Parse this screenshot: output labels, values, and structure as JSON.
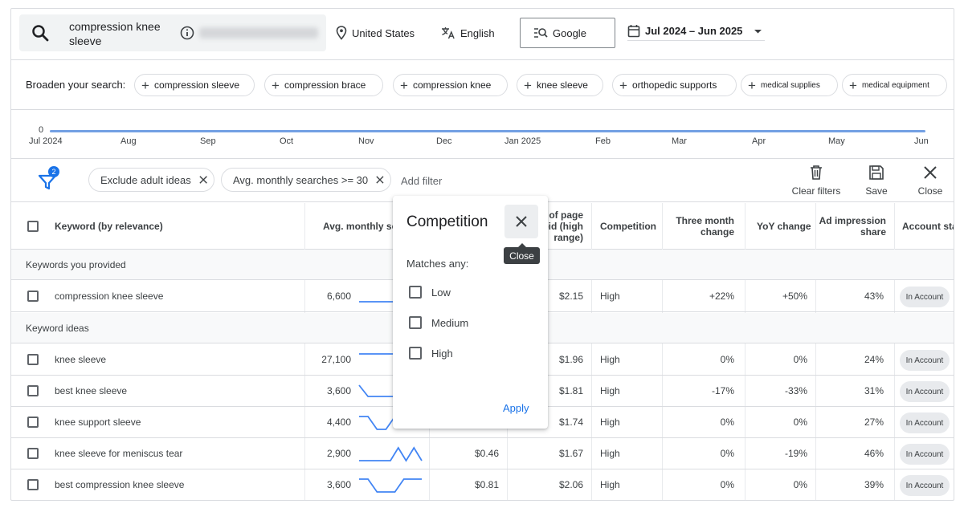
{
  "search": {
    "query": "compression knee sleeve",
    "location": "United States",
    "language": "English",
    "engine": "Google",
    "date_range": "Jul 2024 – Jun 2025"
  },
  "broaden": {
    "label": "Broaden your search:",
    "chips": [
      "compression sleeve",
      "compression brace",
      "compression knee",
      "knee sleeve",
      "orthopedic supports",
      "medical supplies",
      "medical equipment"
    ]
  },
  "timeline": {
    "zero_label": "0",
    "months": [
      "Jul 2024",
      "Aug",
      "Sep",
      "Oct",
      "Nov",
      "Dec",
      "Jan 2025",
      "Feb",
      "Mar",
      "Apr",
      "May",
      "Jun"
    ]
  },
  "filters": {
    "badge": "2",
    "chips": [
      "Exclude adult ideas",
      "Avg. monthly searches >= 30"
    ],
    "add_filter": "Add filter",
    "clear_label": "Clear filters",
    "save_label": "Save",
    "close_label": "Close"
  },
  "table": {
    "headers": {
      "keyword": "Keyword (by relevance)",
      "avg_searches": "Avg. monthly sea",
      "top_bid_line1": "of page",
      "top_bid_line2": "bid (high",
      "top_bid_line3": "range)",
      "competition": "Competition",
      "three_month_line1": "Three month",
      "three_month_line2": "change",
      "yoy": "YoY change",
      "ad_share_line1": "Ad impression",
      "ad_share_line2": "share",
      "account": "Account stat"
    },
    "section_provided": "Keywords you provided",
    "section_ideas": "Keyword ideas",
    "account_badge": "In Account",
    "provided": [
      {
        "keyword": "compression knee sleeve",
        "searches": "6,600",
        "low_bid": "",
        "high_bid": "$2.15",
        "competition": "High",
        "three_month": "+22%",
        "yoy": "+50%",
        "share": "43%",
        "trend": [
          0.2,
          0.2,
          0.2,
          0.2,
          0.2,
          0.2,
          0.2,
          0.2
        ]
      }
    ],
    "ideas": [
      {
        "keyword": "knee sleeve",
        "searches": "27,100",
        "low_bid": "",
        "high_bid": "$1.96",
        "competition": "High",
        "three_month": "0%",
        "yoy": "0%",
        "share": "24%",
        "trend": [
          0.9,
          0.9,
          0.9,
          0.9,
          0.9,
          0.9,
          0.9,
          0.9
        ]
      },
      {
        "keyword": "best knee sleeve",
        "searches": "3,600",
        "low_bid": "",
        "high_bid": "$1.81",
        "competition": "High",
        "three_month": "-17%",
        "yoy": "-33%",
        "share": "31%",
        "trend": [
          0.9,
          0.2,
          0.2,
          0.2,
          0.2,
          0.2,
          0.2,
          0.2
        ]
      },
      {
        "keyword": "knee support sleeve",
        "searches": "4,400",
        "low_bid": "",
        "high_bid": "$1.74",
        "competition": "High",
        "three_month": "0%",
        "yoy": "0%",
        "share": "27%",
        "trend": [
          0.9,
          0.9,
          0.1,
          0.1,
          0.9,
          0.9,
          0.9,
          0.9
        ]
      },
      {
        "keyword": "knee sleeve for meniscus tear",
        "searches": "2,900",
        "low_bid": "$0.46",
        "high_bid": "$1.67",
        "competition": "High",
        "three_month": "0%",
        "yoy": "-19%",
        "share": "46%",
        "trend": [
          0.1,
          0.1,
          0.1,
          0.1,
          0.1,
          0.9,
          0.1,
          0.9,
          0.1
        ]
      },
      {
        "keyword": "best compression knee sleeve",
        "searches": "3,600",
        "low_bid": "$0.81",
        "high_bid": "$2.06",
        "competition": "High",
        "three_month": "0%",
        "yoy": "0%",
        "share": "39%",
        "trend": [
          0.9,
          0.9,
          0.1,
          0.1,
          0.1,
          0.9,
          0.9,
          0.9
        ]
      }
    ]
  },
  "popup": {
    "title": "Competition",
    "matches": "Matches any:",
    "options": [
      "Low",
      "Medium",
      "High"
    ],
    "apply": "Apply",
    "tooltip": "Close"
  },
  "colors": {
    "accent": "#1a73e8",
    "sparkline": "#4285f4"
  },
  "icons": [
    "search-icon",
    "info-icon",
    "location-pin-icon",
    "translate-icon",
    "search-engine-icon",
    "calendar-icon",
    "dropdown-arrow-icon",
    "plus-icon",
    "filter-icon",
    "close-icon",
    "trash-icon",
    "save-icon"
  ]
}
